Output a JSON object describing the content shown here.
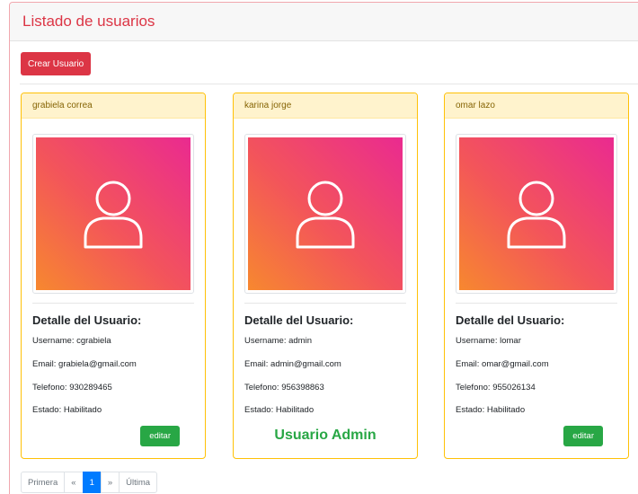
{
  "header": {
    "title": "Listado de usuarios"
  },
  "toolbar": {
    "create_label": "Crear Usuario"
  },
  "cards": [
    {
      "name": "grabiela correa",
      "detail_title": "Detalle del Usuario:",
      "username": "Username: cgrabiela",
      "email": "Email: grabiela@gmail.com",
      "telefono": "Telefono: 930289465",
      "estado": "Estado: Habilitado",
      "action_label": "editar",
      "avatar_icon": "user-icon"
    },
    {
      "name": "karina jorge",
      "detail_title": "Detalle del Usuario:",
      "username": "Username: admin",
      "email": "Email: admin@gmail.com",
      "telefono": "Telefono: 956398863",
      "estado": "Estado: Habilitado",
      "admin_label": "Usuario Admin",
      "avatar_icon": "user-icon"
    },
    {
      "name": "omar lazo",
      "detail_title": "Detalle del Usuario:",
      "username": "Username: lomar",
      "email": "Email: omar@gmail.com",
      "telefono": "Telefono: 955026134",
      "estado": "Estado: Habilitado",
      "action_label": "editar",
      "avatar_icon": "user-icon"
    }
  ],
  "pagination": {
    "first": "Primera",
    "prev": "«",
    "current": "1",
    "next": "»",
    "last": "Última"
  },
  "colors": {
    "accent": "#dc3545",
    "success": "#28a745",
    "primary": "#007bff",
    "card_border": "#ffc107",
    "card_header_bg": "#fff3cd"
  }
}
